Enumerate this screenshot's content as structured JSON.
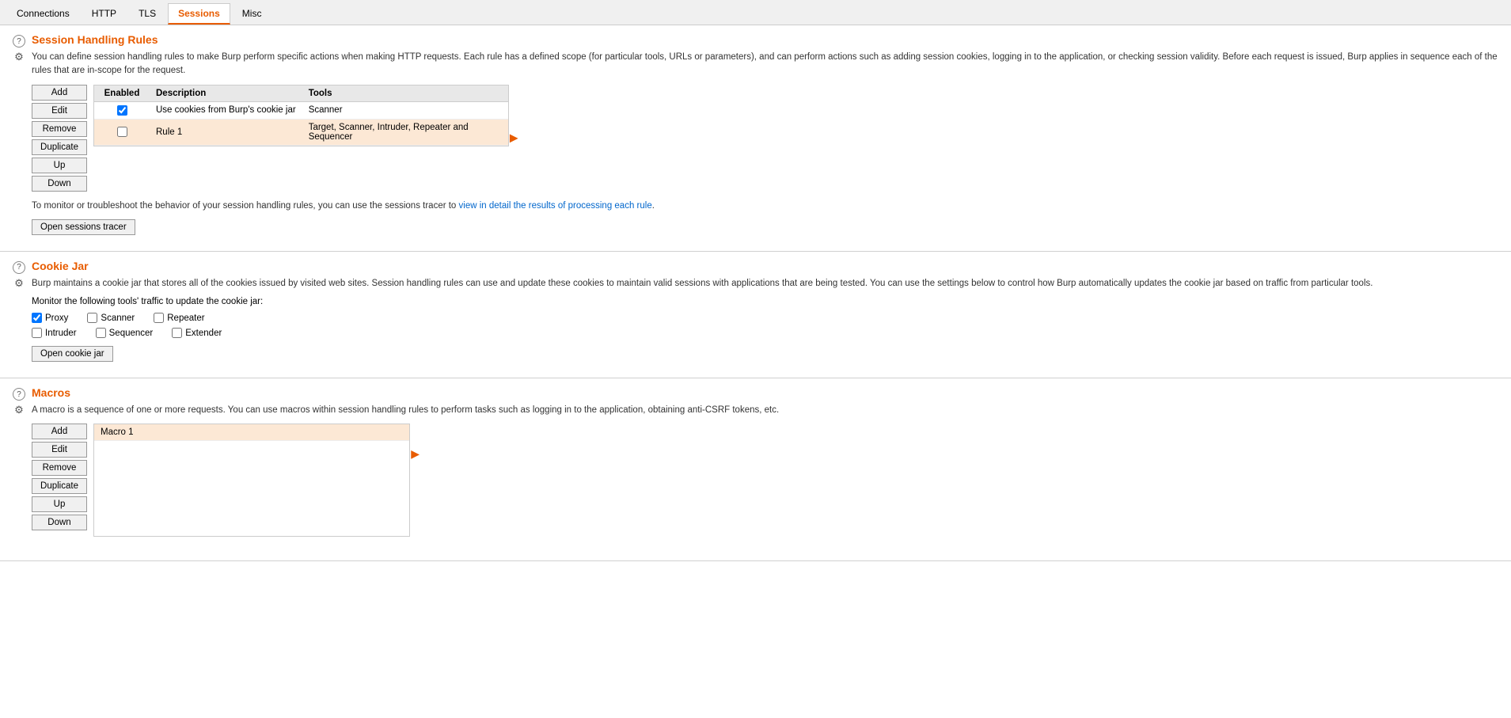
{
  "nav": {
    "tabs": [
      {
        "id": "connections",
        "label": "Connections",
        "active": false
      },
      {
        "id": "http",
        "label": "HTTP",
        "active": false
      },
      {
        "id": "tls",
        "label": "TLS",
        "active": false
      },
      {
        "id": "sessions",
        "label": "Sessions",
        "active": true
      },
      {
        "id": "misc",
        "label": "Misc",
        "active": false
      }
    ]
  },
  "sessionHandling": {
    "title": "Session Handling Rules",
    "description": "You can define session handling rules to make Burp perform specific actions when making HTTP requests. Each rule has a defined scope (for particular tools, URLs or parameters), and can perform actions such as adding session cookies, logging in to the application, or checking session validity. Before each request is issued, Burp applies in sequence each of the rules that are in-scope for the request.",
    "buttons": {
      "add": "Add",
      "edit": "Edit",
      "remove": "Remove",
      "duplicate": "Duplicate",
      "up": "Up",
      "down": "Down"
    },
    "table": {
      "columns": [
        "Enabled",
        "Description",
        "Tools"
      ],
      "rows": [
        {
          "enabled": true,
          "checked": true,
          "description": "Use cookies from Burp's cookie jar",
          "tools": "Scanner",
          "selected": false
        },
        {
          "enabled": true,
          "checked": false,
          "description": "Rule 1",
          "tools": "Target, Scanner, Intruder, Repeater and Sequencer",
          "selected": true
        }
      ]
    },
    "tracerDesc": "To monitor or troubleshoot the behavior of your session handling rules, you can use the sessions tracer to view in detail the results of processing each rule.",
    "tracerLinkText": "view in detail the results of processing each rule",
    "openTracerBtn": "Open sessions tracer"
  },
  "cookieJar": {
    "title": "Cookie Jar",
    "description": "Burp maintains a cookie jar that stores all of the cookies issued by visited web sites. Session handling rules can use and update these cookies to maintain valid sessions with applications that are being tested. You can use the settings below to control how Burp automatically updates the cookie jar based on traffic from particular tools.",
    "monitorLabel": "Monitor the following tools' traffic to update the cookie jar:",
    "tools": [
      {
        "label": "Proxy",
        "checked": true
      },
      {
        "label": "Scanner",
        "checked": false
      },
      {
        "label": "Repeater",
        "checked": false
      },
      {
        "label": "Intruder",
        "checked": false
      },
      {
        "label": "Sequencer",
        "checked": false
      },
      {
        "label": "Extender",
        "checked": false
      }
    ],
    "openCookieJarBtn": "Open cookie jar"
  },
  "macros": {
    "title": "Macros",
    "description": "A macro is a sequence of one or more requests. You can use macros within session handling rules to perform tasks such as logging in to the application, obtaining anti-CSRF tokens, etc.",
    "buttons": {
      "add": "Add",
      "edit": "Edit",
      "remove": "Remove",
      "duplicate": "Duplicate",
      "up": "Up",
      "down": "Down"
    },
    "rows": [
      {
        "label": "Macro 1",
        "selected": true
      }
    ]
  },
  "icons": {
    "help": "?",
    "gear": "⚙",
    "arrow": "▶"
  }
}
